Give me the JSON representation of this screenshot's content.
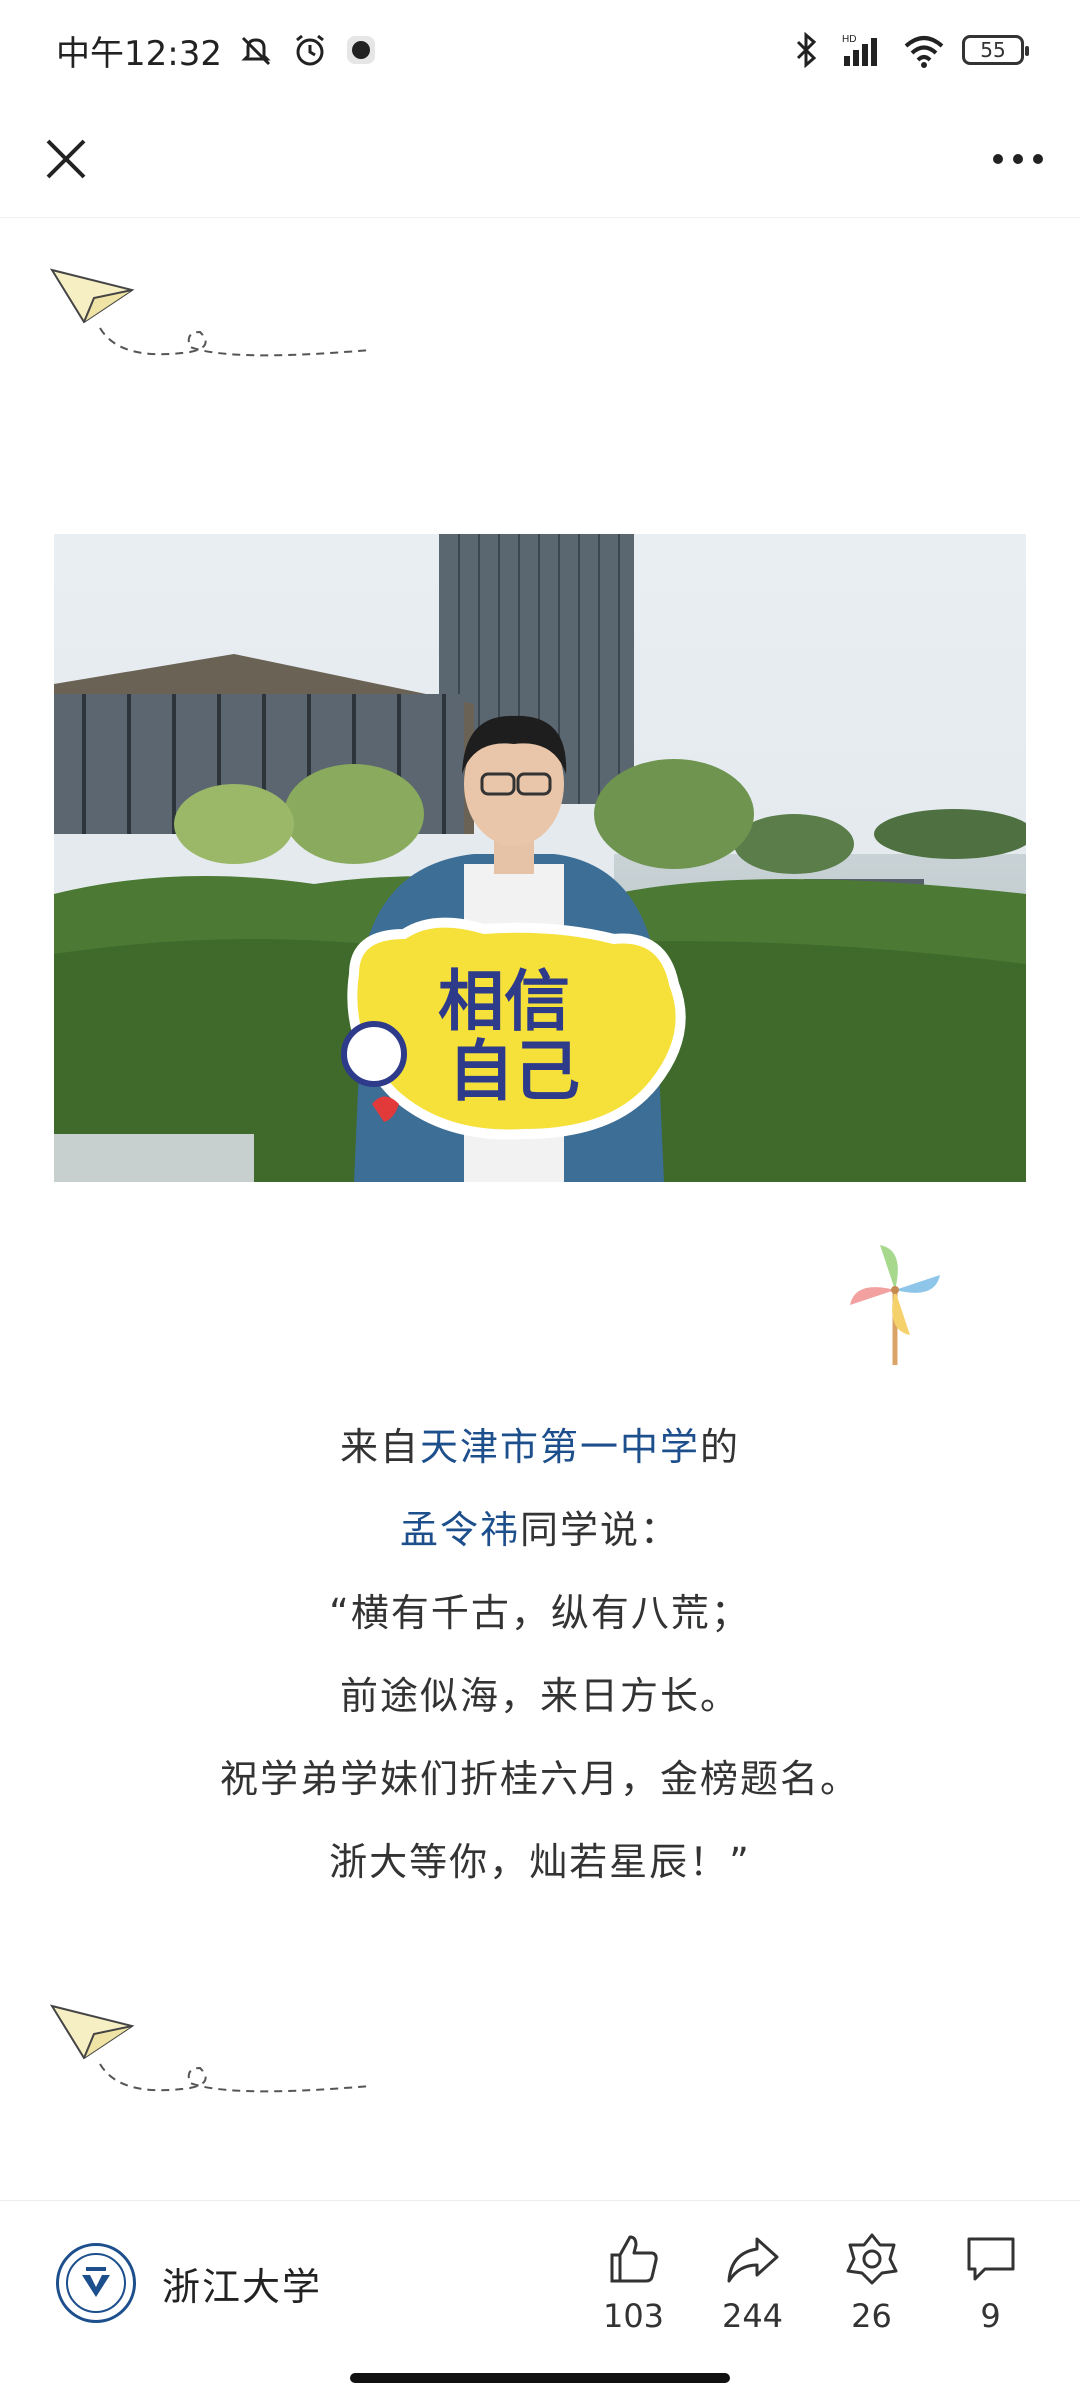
{
  "status_bar": {
    "time": "中午12:32",
    "battery": "55"
  },
  "quote": {
    "line1_prefix": "来自",
    "school": "天津市第一中学",
    "line1_suffix": "的",
    "student": "孟令祎",
    "line2_suffix": "同学说：",
    "line3": "“横有千古，纵有八荒；",
    "line4": "前途似海，来日方长。",
    "line5": "祝学弟学妹们折桂六月，金榜题名。",
    "line6": "浙大等你，灿若星辰！”"
  },
  "photo": {
    "sign_text_line1": "相信",
    "sign_text_line2": "自己"
  },
  "account": {
    "name": "浙江大学"
  },
  "actions": {
    "like_count": "103",
    "share_count": "244",
    "star_count": "26",
    "comment_count": "9"
  },
  "colors": {
    "highlight": "#1d4f8c",
    "text": "#333333"
  },
  "icons": [
    "close-icon",
    "more-icon",
    "like-icon",
    "share-icon",
    "favorite-icon",
    "comment-icon",
    "paper-plane-icon",
    "pinwheel-icon"
  ]
}
